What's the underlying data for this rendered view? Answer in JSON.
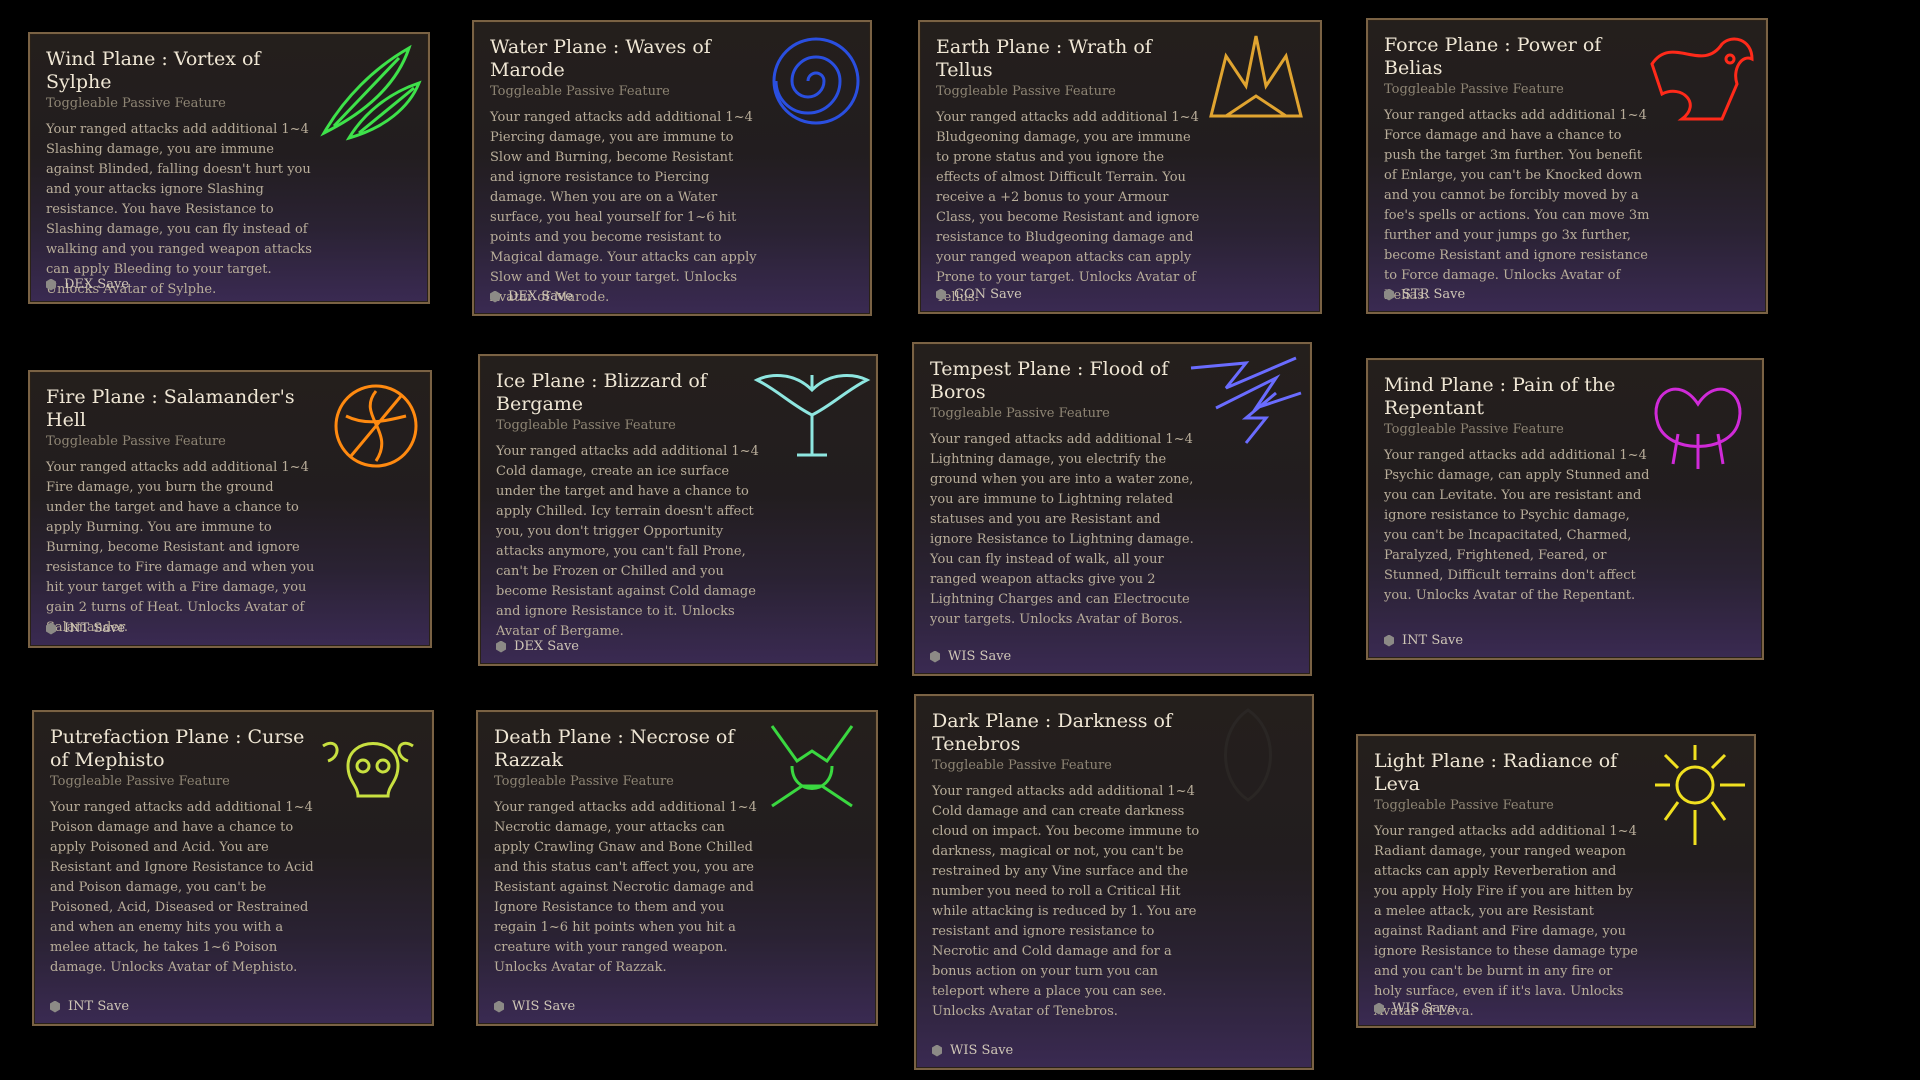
{
  "feature_type": "Toggleable Passive Feature",
  "cards": [
    {
      "title": "Wind Plane : Vortex of Sylphe",
      "save": "DEX Save",
      "desc": "Your ranged attacks add additional 1~4 Slashing damage, you are immune against Blinded, falling doesn't hurt you and your attacks ignore Slashing resistance. You have Resistance to Slashing damage, you can fly instead of walking and you ranged weapon attacks can apply Bleeding to your target. Unlocks Avatar of Sylphe.",
      "icon": "wind-feathers-icon",
      "color": "#3ee24a"
    },
    {
      "title": "Water Plane : Waves of Marode",
      "save": "DEX Save",
      "desc": "Your ranged attacks add additional 1~4 Piercing damage, you are immune to Slow and Burning, become Resistant and ignore resistance to Piercing damage. When you are on a Water surface, you heal yourself for 1~6 hit points and you become resistant to Magical damage. Your attacks can apply Slow and Wet to your target. Unlocks Avatar of Marode.",
      "icon": "water-spiral-icon",
      "color": "#2a4fe0"
    },
    {
      "title": "Earth Plane : Wrath of Tellus",
      "save": "CON Save",
      "desc": "Your ranged attacks add additional 1~4 Bludgeoning damage, you are immune to prone status and you ignore the effects of almost Difficult Terrain. You receive a +2 bonus to your Armour Class, you become Resistant and ignore resistance to Bludgeoning damage and your ranged weapon attacks can apply Prone to your target. Unlocks Avatar of Tellus.",
      "icon": "earth-crown-icon",
      "color": "#e0a430"
    },
    {
      "title": "Force Plane : Power of Belias",
      "save": "STR Save",
      "desc": "Your ranged attacks add additional 1~4 Force damage and have a chance to push the target 3m further. You benefit of Enlarge, you can't be Knocked down and you cannot be forcibly moved by a foe's spells or actions. You can move 3m further and your jumps go 3x further, become Resistant and ignore resistance to Force damage. Unlocks Avatar of Belias.",
      "icon": "force-beast-icon",
      "color": "#ff2a1a"
    },
    {
      "title": "Fire Plane : Salamander's Hell",
      "save": "INT Save",
      "desc": "Your ranged attacks add additional 1~4 Fire damage, you burn the ground under the target and have a chance to apply Burning. You are immune to Burning, become Resistant and ignore resistance to Fire damage and when you hit your target with a Fire damage, you gain 2 turns of Heat. Unlocks Avatar of Salamander.",
      "icon": "fire-salamander-icon",
      "color": "#ff8a10"
    },
    {
      "title": "Ice Plane : Blizzard of Bergame",
      "save": "DEX Save",
      "desc": "Your ranged attacks add additional 1~4 Cold damage, create an ice surface under the target and have a chance to apply Chilled. Icy terrain doesn't affect you, you don't trigger Opportunity attacks anymore, you can't fall Prone, can't be Frozen or Chilled and you become Resistant against Cold damage and ignore Resistance to it. Unlocks Avatar of Bergame.",
      "icon": "ice-bird-icon",
      "color": "#8ee6e0"
    },
    {
      "title": "Tempest Plane : Flood of Boros",
      "save": "WIS Save",
      "desc": "Your ranged attacks add additional 1~4 Lightning damage, you electrify the ground when you are into a water zone, you are immune to Lightning related statuses and you are Resistant and ignore Resistance to Lightning damage. You can fly instead of walk, all your ranged weapon attacks give you 2 Lightning Charges and can Electrocute your targets. Unlocks Avatar of Boros.",
      "icon": "tempest-lightning-icon",
      "color": "#6a6cff"
    },
    {
      "title": "Mind Plane : Pain of the Repentant",
      "save": "INT Save",
      "desc": "Your ranged attacks add additional 1~4 Psychic damage, can apply Stunned and you can Levitate. You are resistant and ignore resistance to Psychic damage, you can't be Incapacitated, Charmed, Paralyzed, Frightened, Feared, or Stunned, Difficult terrains don't affect you. Unlocks Avatar of the Repentant.",
      "icon": "mind-tentacles-icon",
      "color": "#d02ad8"
    },
    {
      "title": "Putrefaction Plane : Curse of Mephisto",
      "save": "INT Save",
      "desc": "Your ranged attacks add additional 1~4 Poison damage and have a chance to apply Poisoned and Acid. You are Resistant and Ignore Resistance to Acid and Poison damage, you can't be Poisoned, Acid, Diseased or Restrained and when an enemy hits you with a melee attack, he takes 1~6 Poison damage. Unlocks Avatar of Mephisto.",
      "icon": "poison-skull-icon",
      "color": "#c8e040"
    },
    {
      "title": "Death Plane : Necrose of Razzak",
      "save": "WIS Save",
      "desc": "Your ranged attacks add additional 1~4 Necrotic damage, your attacks can apply Crawling Gnaw and Bone Chilled and this status can't affect you, you are Resistant against Necrotic damage and Ignore Resistance to them and you regain 1~6 hit points when you hit a creature with your ranged weapon. Unlocks Avatar of Razzak.",
      "icon": "death-demon-icon",
      "color": "#3ad840"
    },
    {
      "title": "Dark Plane : Darkness of Tenebros",
      "save": "WIS Save",
      "desc": "Your ranged attacks add additional 1~4 Cold damage and can create darkness cloud on impact. You become immune to darkness, magical or not, you can't be restrained by any Vine surface and the number you need to roll a Critical Hit while attacking is reduced by 1. You are resistant and ignore resistance to Necrotic and Cold damage and for a bonus action on your turn you can teleport where a place you can see. Unlocks Avatar of Tenebros.",
      "icon": "dark-shadow-icon",
      "color": "#2a2624"
    },
    {
      "title": "Light Plane : Radiance of Leva",
      "save": "WIS Save",
      "desc": "Your ranged attacks add additional 1~4 Radiant damage, your ranged weapon attacks can apply Reverberation and you apply Holy Fire if you are hitten by a melee attack, you are Resistant against Radiant and Fire damage, you ignore Resistance to these damage type and you can't be burnt in any fire or holy surface, even if it's lava. Unlocks Avatar of Leva.",
      "icon": "light-sun-icon",
      "color": "#f0e020"
    }
  ]
}
